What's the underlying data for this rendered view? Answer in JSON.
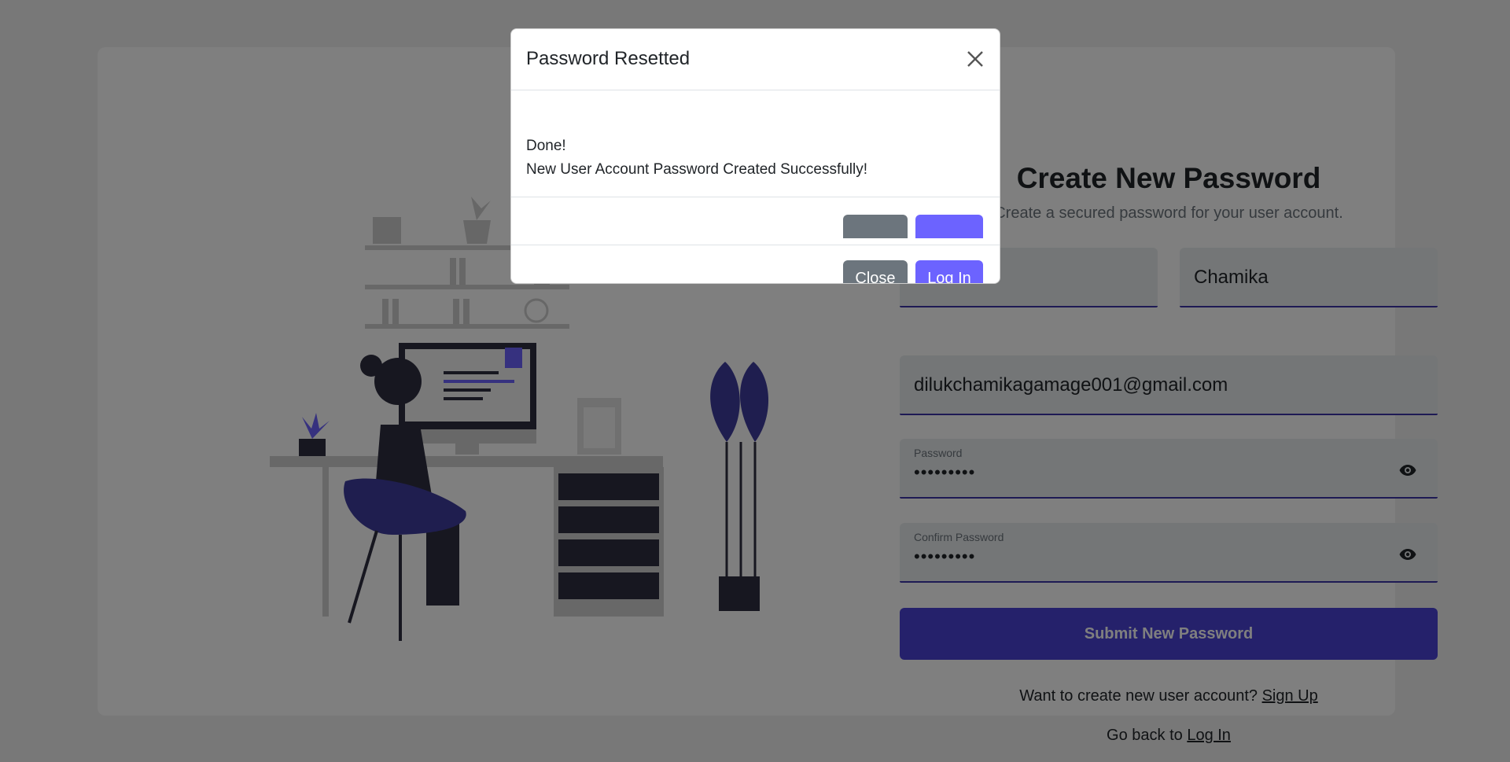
{
  "form": {
    "title": "Create New Password",
    "subtitle": "Create a secured password for your user account.",
    "first_name": "",
    "last_name": "Chamika",
    "email": "dilukchamikagamage001@gmail.com",
    "password_label": "Password",
    "password_masked": "•••••••••",
    "confirm_label": "Confirm Password",
    "confirm_masked": "•••••••••",
    "submit_label": "Submit New Password",
    "signup_prompt": "Want to create new user account?",
    "signup_link": "Sign Up",
    "back_prompt": "Go back to",
    "login_link": "Log In"
  },
  "modal": {
    "title": "Password Resetted",
    "line1": "Done!",
    "line2": "New User Account Password Created Successfully!",
    "close_label": "Close",
    "login_label": "Log In"
  },
  "colors": {
    "accent": "#6c63ff",
    "accent_dark": "#4b42d6",
    "secondary": "#6c757d"
  },
  "icons": [
    "close-icon",
    "eye-icon",
    "desk-illustration"
  ]
}
